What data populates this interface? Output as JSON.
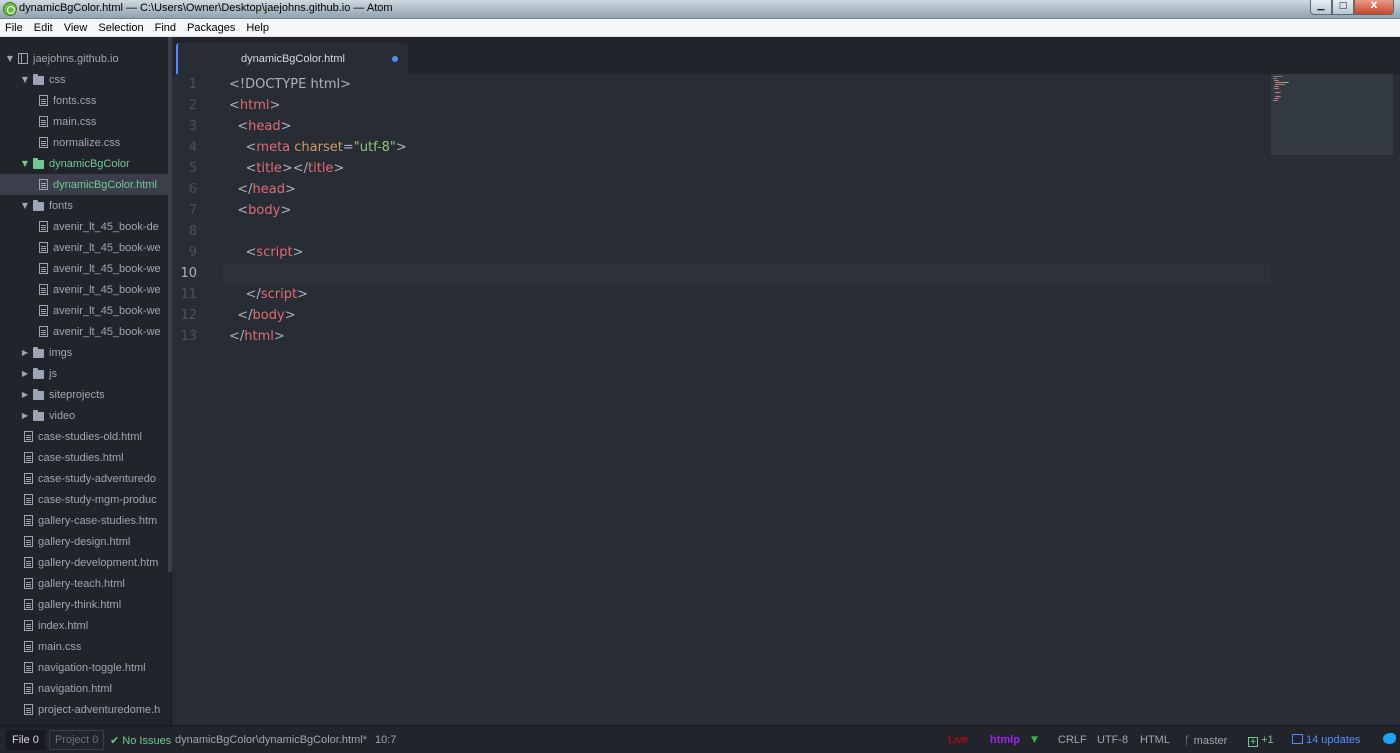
{
  "window": {
    "title": "dynamicBgColor.html — C:\\Users\\Owner\\Desktop\\jaejohns.github.io — Atom",
    "min_glyph": "▁",
    "max_glyph": "□",
    "close_glyph": "X"
  },
  "menu": [
    "File",
    "Edit",
    "View",
    "Selection",
    "Find",
    "Packages",
    "Help"
  ],
  "tree": {
    "rows": [
      {
        "label": "jaejohns.github.io",
        "type": "repo",
        "indent": 0,
        "chevron": "▼"
      },
      {
        "label": "css",
        "type": "folder",
        "indent": 1,
        "chevron": "▼"
      },
      {
        "label": "fonts.css",
        "type": "file",
        "indent": 2
      },
      {
        "label": "main.css",
        "type": "file",
        "indent": 2
      },
      {
        "label": "normalize.css",
        "type": "file",
        "indent": 2
      },
      {
        "label": "dynamicBgColor",
        "type": "folder",
        "indent": 1,
        "chevron": "▼",
        "status": "added"
      },
      {
        "label": "dynamicBgColor.html",
        "type": "file",
        "indent": 2,
        "status": "added",
        "selected": true
      },
      {
        "label": "fonts",
        "type": "folder",
        "indent": 1,
        "chevron": "▼"
      },
      {
        "label": "avenir_lt_45_book-de",
        "type": "file",
        "indent": 2
      },
      {
        "label": "avenir_lt_45_book-we",
        "type": "file",
        "indent": 2
      },
      {
        "label": "avenir_lt_45_book-we",
        "type": "file",
        "indent": 2
      },
      {
        "label": "avenir_lt_45_book-we",
        "type": "file",
        "indent": 2
      },
      {
        "label": "avenir_lt_45_book-we",
        "type": "file",
        "indent": 2
      },
      {
        "label": "avenir_lt_45_book-we",
        "type": "file",
        "indent": 2
      },
      {
        "label": "imgs",
        "type": "folder",
        "indent": 1,
        "chevron": "▶"
      },
      {
        "label": "js",
        "type": "folder",
        "indent": 1,
        "chevron": "▶"
      },
      {
        "label": "siteprojects",
        "type": "folder",
        "indent": 1,
        "chevron": "▶"
      },
      {
        "label": "video",
        "type": "folder",
        "indent": 1,
        "chevron": "▶"
      },
      {
        "label": "case-studies-old.html",
        "type": "file",
        "indent": 1
      },
      {
        "label": "case-studies.html",
        "type": "file",
        "indent": 1
      },
      {
        "label": "case-study-adventuredo",
        "type": "file",
        "indent": 1
      },
      {
        "label": "case-study-mgm-produc",
        "type": "file",
        "indent": 1
      },
      {
        "label": "gallery-case-studies.htm",
        "type": "file",
        "indent": 1
      },
      {
        "label": "gallery-design.html",
        "type": "file",
        "indent": 1
      },
      {
        "label": "gallery-development.htm",
        "type": "file",
        "indent": 1
      },
      {
        "label": "gallery-teach.html",
        "type": "file",
        "indent": 1
      },
      {
        "label": "gallery-think.html",
        "type": "file",
        "indent": 1
      },
      {
        "label": "index.html",
        "type": "file",
        "indent": 1
      },
      {
        "label": "main.css",
        "type": "file",
        "indent": 1
      },
      {
        "label": "navigation-toggle.html",
        "type": "file",
        "indent": 1
      },
      {
        "label": "navigation.html",
        "type": "file",
        "indent": 1
      },
      {
        "label": "project-adventuredome.h",
        "type": "file",
        "indent": 1
      }
    ]
  },
  "editor": {
    "tab_title": "dynamicBgColor.html",
    "tab_modified": true,
    "cursor_line": 10,
    "lines": [
      [
        [
          "punc",
          "<!DOCTYPE html>"
        ]
      ],
      [
        [
          "punc",
          "<"
        ],
        [
          "tag",
          "html"
        ],
        [
          "punc",
          ">"
        ]
      ],
      [
        [
          "punc",
          "  <"
        ],
        [
          "tag",
          "head"
        ],
        [
          "punc",
          ">"
        ]
      ],
      [
        [
          "punc",
          "    <"
        ],
        [
          "tag",
          "meta "
        ],
        [
          "attr",
          "charset"
        ],
        [
          "punc",
          "="
        ],
        [
          "str",
          "\"utf-8\""
        ],
        [
          "punc",
          ">"
        ]
      ],
      [
        [
          "punc",
          "    <"
        ],
        [
          "tag",
          "title"
        ],
        [
          "punc",
          "></"
        ],
        [
          "tag",
          "title"
        ],
        [
          "punc",
          ">"
        ]
      ],
      [
        [
          "punc",
          "  </"
        ],
        [
          "tag",
          "head"
        ],
        [
          "punc",
          ">"
        ]
      ],
      [
        [
          "punc",
          "  <"
        ],
        [
          "tag",
          "body"
        ],
        [
          "punc",
          ">"
        ]
      ],
      [],
      [
        [
          "punc",
          "    <"
        ],
        [
          "tag",
          "script"
        ],
        [
          "punc",
          ">"
        ]
      ],
      [],
      [
        [
          "punc",
          "    </"
        ],
        [
          "tag",
          "script"
        ],
        [
          "punc",
          ">"
        ]
      ],
      [
        [
          "punc",
          "  </"
        ],
        [
          "tag",
          "body"
        ],
        [
          "punc",
          ">"
        ]
      ],
      [
        [
          "punc",
          "</"
        ],
        [
          "tag",
          "html"
        ],
        [
          "punc",
          ">"
        ]
      ]
    ]
  },
  "status": {
    "file_tab": "File 0",
    "project_tab": "Project 0",
    "check_icon": "✔",
    "issues": "No Issues",
    "path": "dynamicBgColor\\dynamicBgColor.html*",
    "cursor": "10:7",
    "live": "Live",
    "htmlp": "htmlp",
    "htmlp_arrow": "▼",
    "line_ending": "CRLF",
    "encoding": "UTF-8",
    "grammar": "HTML",
    "branch_icon": "ᚴ",
    "branch": "master",
    "git_add_icon": "+",
    "git_added": "+1",
    "updates": "14 updates"
  },
  "colors": {
    "accent": "#528bff",
    "tag": "#e06c75",
    "attr": "#d19a66",
    "string": "#98c379",
    "added": "#73c990",
    "live": "#e00000",
    "htmlp": "#a020f0"
  }
}
